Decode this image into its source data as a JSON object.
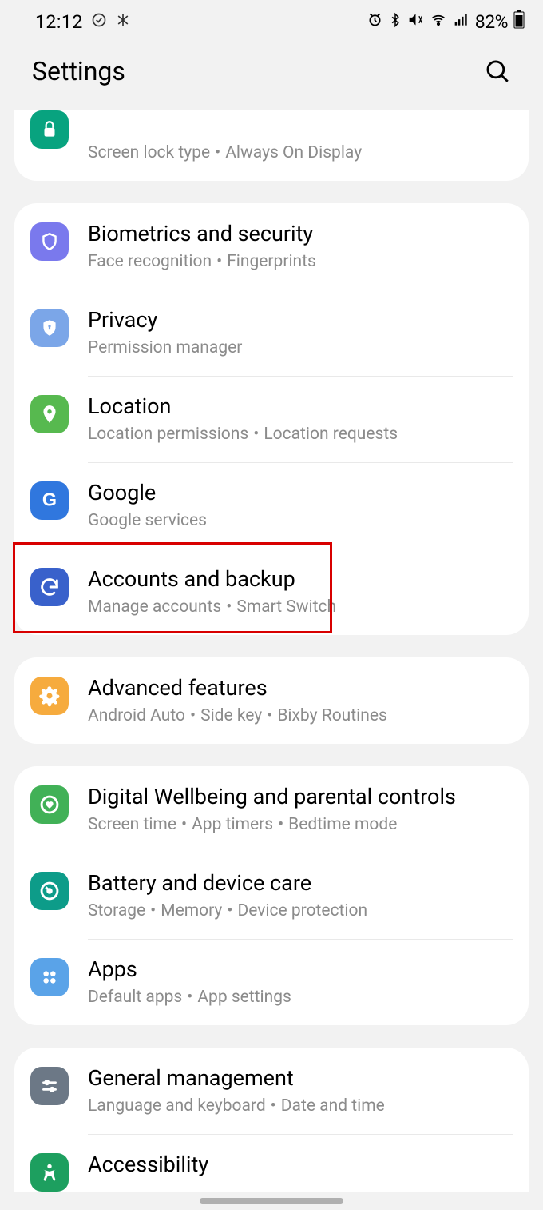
{
  "status_bar": {
    "time": "12:12",
    "battery": "82%"
  },
  "header": {
    "title": "Settings"
  },
  "groups": [
    {
      "partial_top": true,
      "items": [
        {
          "icon": "lock",
          "icon_bg": "#08a37f",
          "title_hidden": true,
          "sub": [
            "Screen lock type",
            "Always On Display"
          ]
        }
      ]
    },
    {
      "items": [
        {
          "icon": "shield-outline",
          "icon_bg": "#7a79ed",
          "title": "Biometrics and security",
          "sub": [
            "Face recognition",
            "Fingerprints"
          ]
        },
        {
          "icon": "shield-lock",
          "icon_bg": "#7ba6e8",
          "title": "Privacy",
          "sub": [
            "Permission manager"
          ]
        },
        {
          "icon": "pin",
          "icon_bg": "#57b94f",
          "title": "Location",
          "sub": [
            "Location permissions",
            "Location requests"
          ]
        },
        {
          "icon": "google-g",
          "icon_bg": "#3077de",
          "title": "Google",
          "sub": [
            "Google services"
          ]
        },
        {
          "icon": "sync",
          "icon_bg": "#3961cb",
          "title": "Accounts and backup",
          "sub": [
            "Manage accounts",
            "Smart Switch"
          ],
          "highlighted": true
        }
      ]
    },
    {
      "items": [
        {
          "icon": "gear-flower",
          "icon_bg": "#f6ab3e",
          "title": "Advanced features",
          "sub": [
            "Android Auto",
            "Side key",
            "Bixby Routines"
          ]
        }
      ]
    },
    {
      "items": [
        {
          "icon": "heart-circle",
          "icon_bg": "#41b157",
          "title": "Digital Wellbeing and parental controls",
          "sub": [
            "Screen time",
            "App timers",
            "Bedtime mode"
          ]
        },
        {
          "icon": "meter",
          "icon_bg": "#0d9c89",
          "title": "Battery and device care",
          "sub": [
            "Storage",
            "Memory",
            "Device protection"
          ]
        },
        {
          "icon": "apps-grid",
          "icon_bg": "#5aa3e8",
          "title": "Apps",
          "sub": [
            "Default apps",
            "App settings"
          ]
        }
      ]
    },
    {
      "partial_bottom": true,
      "items": [
        {
          "icon": "sliders",
          "icon_bg": "#6c7886",
          "title": "General management",
          "sub": [
            "Language and keyboard",
            "Date and time"
          ]
        },
        {
          "icon": "accessibility",
          "icon_bg": "#1d9f5f",
          "title": "Accessibility",
          "sub_hidden": true
        }
      ]
    }
  ]
}
